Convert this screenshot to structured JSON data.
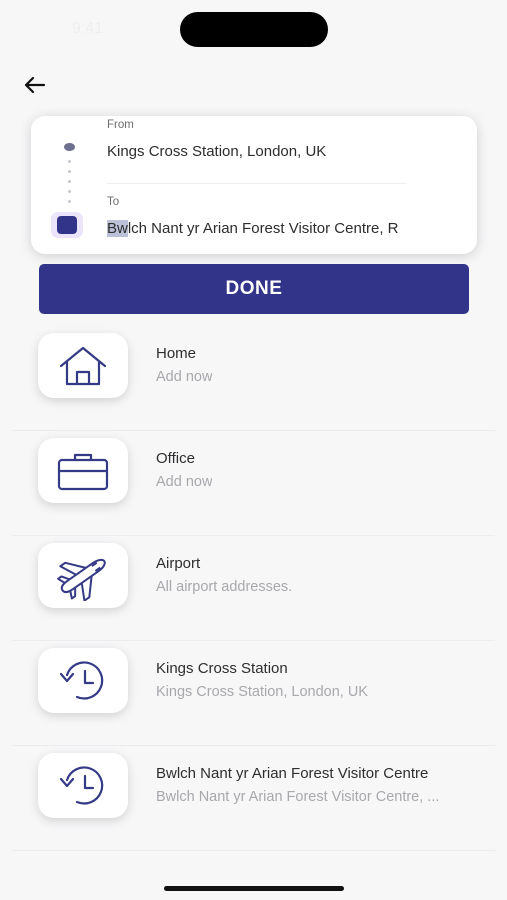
{
  "status_bar": {
    "time": "9:41",
    "right": ""
  },
  "route": {
    "from_label": "From",
    "from_value": "Kings Cross Station, London, UK",
    "to_label": "To",
    "to_value_highlighted": "Bw",
    "to_value_rest": "lch Nant yr Arian Forest Visitor Centre, R"
  },
  "done_label": "DONE",
  "places": [
    {
      "title": "Home",
      "subtitle": "Add now",
      "icon": "home-icon"
    },
    {
      "title": "Office",
      "subtitle": "Add now",
      "icon": "briefcase-icon"
    },
    {
      "title": "Airport",
      "subtitle": "All airport addresses.",
      "icon": "airplane-icon"
    },
    {
      "title": "Kings Cross Station",
      "subtitle": "Kings Cross Station, London, UK",
      "icon": "history-icon"
    },
    {
      "title": "Bwlch Nant yr Arian Forest Visitor Centre",
      "subtitle": "Bwlch Nant yr Arian Forest Visitor Centre, ...",
      "icon": "history-icon"
    }
  ],
  "colors": {
    "accent": "#313488",
    "icon_stroke": "#353a86",
    "muted_text": "#a8a8ad"
  }
}
